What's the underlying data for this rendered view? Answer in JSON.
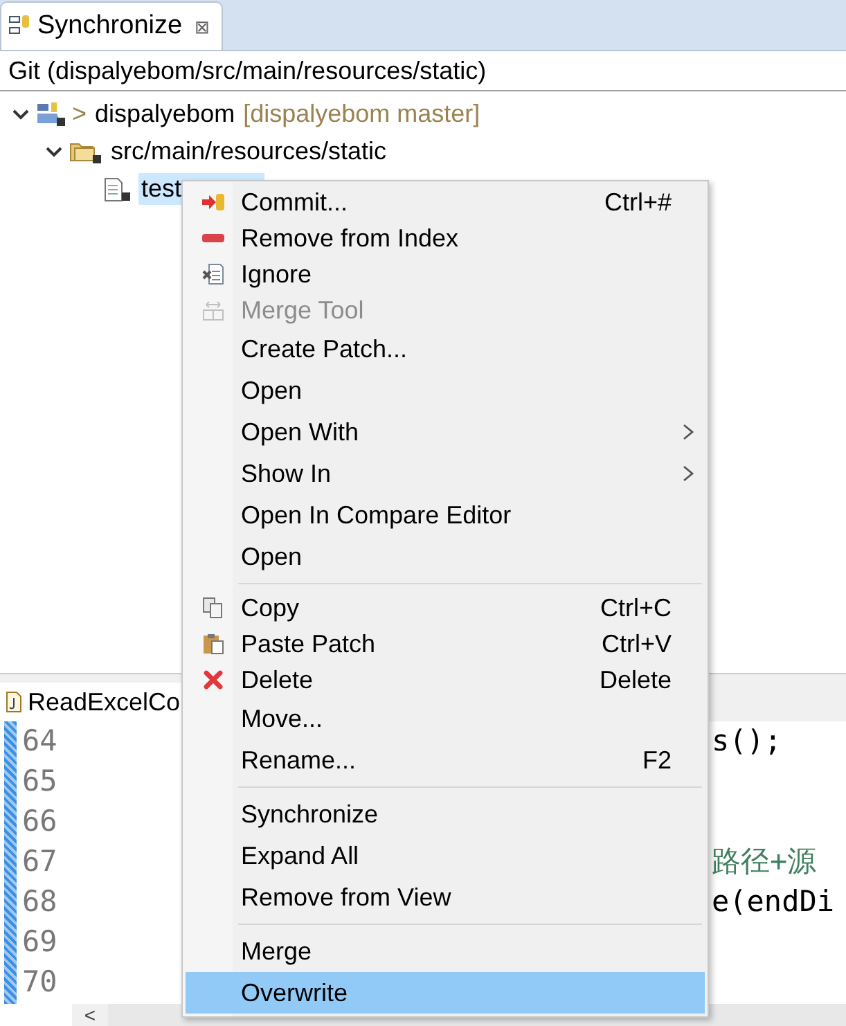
{
  "view": {
    "tab": {
      "label": "Synchronize",
      "close": "⊠",
      "selected": true
    },
    "header": "Git (dispalyebom/src/main/resources/static)",
    "tree": [
      {
        "kind": "project",
        "prefix": ">",
        "label": "dispalyebom",
        "decoration": "[dispalyebom master]",
        "expanded": true,
        "selected": false,
        "children": [
          {
            "kind": "folder",
            "label": "src/main/resources/static",
            "expanded": true,
            "selected": false,
            "children": [
              {
                "kind": "file",
                "label": "test",
                "selected": true
              }
            ]
          }
        ]
      }
    ]
  },
  "editor": {
    "tab": {
      "label": "ReadExcelCo",
      "selected": true
    },
    "lines": [
      {
        "number": "64",
        "code": "s();",
        "kind": "code"
      },
      {
        "number": "65"
      },
      {
        "number": "66"
      },
      {
        "number": "67",
        "code": "路径+源",
        "kind": "comment"
      },
      {
        "number": "68",
        "code": "e(endDi",
        "kind": "code"
      },
      {
        "number": "69"
      },
      {
        "number": "70"
      }
    ],
    "scroll_left": "<"
  },
  "menu": {
    "groups": [
      {
        "items": [
          {
            "kind": "commit",
            "label": "Commit...",
            "shortcut": "Ctrl+#",
            "submenu": false,
            "disabled": false,
            "selected": false
          },
          {
            "kind": "remove",
            "label": "Remove from Index",
            "submenu": false,
            "disabled": false,
            "selected": false
          },
          {
            "kind": "ignore",
            "label": "Ignore",
            "submenu": false,
            "disabled": false,
            "selected": false
          },
          {
            "kind": "merge",
            "label": "Merge Tool",
            "submenu": false,
            "disabled": true,
            "selected": false
          },
          {
            "kind": "plain",
            "label": "Create Patch...",
            "submenu": false,
            "disabled": false,
            "selected": false
          },
          {
            "kind": "plain",
            "label": "Open",
            "submenu": false,
            "disabled": false,
            "selected": false
          },
          {
            "kind": "plain",
            "label": "Open With",
            "submenu": true,
            "disabled": false,
            "selected": false
          },
          {
            "kind": "plain",
            "label": "Show In",
            "submenu": true,
            "disabled": false,
            "selected": false
          },
          {
            "kind": "plain",
            "label": "Open In Compare Editor",
            "submenu": false,
            "disabled": false,
            "selected": false
          },
          {
            "kind": "plain",
            "label": "Open",
            "submenu": false,
            "disabled": false,
            "selected": false
          }
        ]
      },
      {
        "items": [
          {
            "kind": "copy",
            "label": "Copy",
            "shortcut": "Ctrl+C",
            "submenu": false,
            "disabled": false,
            "selected": false
          },
          {
            "kind": "paste",
            "label": "Paste Patch",
            "shortcut": "Ctrl+V",
            "submenu": false,
            "disabled": false,
            "selected": false
          },
          {
            "kind": "delete",
            "label": "Delete",
            "shortcut": "Delete",
            "submenu": false,
            "disabled": false,
            "selected": false
          },
          {
            "kind": "plain",
            "label": "Move...",
            "submenu": false,
            "disabled": false,
            "selected": false
          },
          {
            "kind": "plain",
            "label": "Rename...",
            "shortcut": "F2",
            "submenu": false,
            "disabled": false,
            "selected": false
          }
        ]
      },
      {
        "items": [
          {
            "kind": "plain",
            "label": "Synchronize",
            "submenu": false,
            "disabled": false,
            "selected": false
          },
          {
            "kind": "plain",
            "label": "Expand All",
            "submenu": false,
            "disabled": false,
            "selected": false
          },
          {
            "kind": "plain",
            "label": "Remove from View",
            "submenu": false,
            "disabled": false,
            "selected": false
          }
        ]
      },
      {
        "items": [
          {
            "kind": "plain",
            "label": "Merge",
            "submenu": false,
            "disabled": false,
            "selected": false
          },
          {
            "kind": "plain",
            "label": "Overwrite",
            "submenu": false,
            "disabled": false,
            "selected": true
          }
        ]
      }
    ]
  }
}
